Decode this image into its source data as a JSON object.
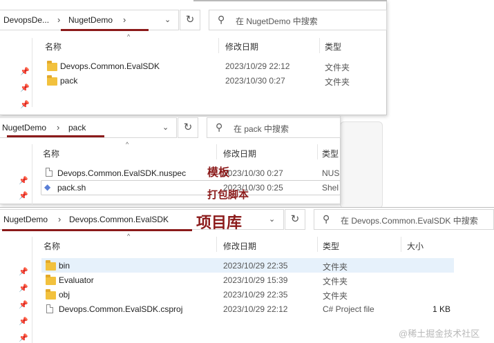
{
  "window1": {
    "breadcrumb": [
      "DevopsDe...",
      "NugetDemo"
    ],
    "search_placeholder": "在 NugetDemo 中搜索",
    "columns": [
      "名称",
      "修改日期",
      "类型"
    ],
    "rows": [
      {
        "name": "Devops.Common.EvalSDK",
        "date": "2023/10/29 22:12",
        "type": "文件夹",
        "icon": "folder-icon"
      },
      {
        "name": "pack",
        "date": "2023/10/30 0:27",
        "type": "文件夹",
        "icon": "folder-icon"
      }
    ]
  },
  "window2": {
    "breadcrumb": [
      "NugetDemo",
      "pack"
    ],
    "search_placeholder": "在 pack 中搜索",
    "columns": [
      "名称",
      "修改日期",
      "类型"
    ],
    "rows": [
      {
        "name": "Devops.Common.EvalSDK.nuspec",
        "date": "2023/10/30 0:27",
        "type": "NUS",
        "icon": "file-icon"
      },
      {
        "name": "pack.sh",
        "date": "2023/10/30 0:25",
        "type": "Shel",
        "icon": "script-icon"
      }
    ]
  },
  "window3": {
    "breadcrumb": [
      "NugetDemo",
      "Devops.Common.EvalSDK"
    ],
    "search_placeholder": "在 Devops.Common.EvalSDK 中搜索",
    "columns": [
      "名称",
      "修改日期",
      "类型",
      "大小"
    ],
    "rows": [
      {
        "name": "bin",
        "date": "2023/10/29 22:35",
        "type": "文件夹",
        "size": "",
        "icon": "folder-icon"
      },
      {
        "name": "Evaluator",
        "date": "2023/10/29 15:39",
        "type": "文件夹",
        "size": "",
        "icon": "folder-icon"
      },
      {
        "name": "obj",
        "date": "2023/10/29 22:35",
        "type": "文件夹",
        "size": "",
        "icon": "folder-icon"
      },
      {
        "name": "Devops.Common.EvalSDK.csproj",
        "date": "2023/10/29 22:12",
        "type": "C# Project file",
        "size": "1 KB",
        "icon": "file-icon"
      }
    ]
  },
  "annotations": {
    "template": "模板",
    "pack_script": "打包脚本",
    "project": "项目库"
  },
  "watermark": "@稀土掘金技术社区",
  "colors": {
    "annotation": "#8b1a1a",
    "folder": "#f2c13d",
    "selected_row": "#e6f1fb"
  }
}
